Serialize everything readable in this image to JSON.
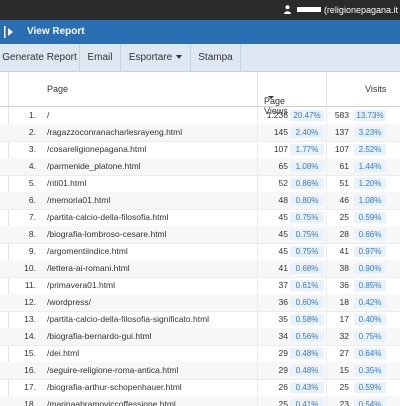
{
  "topbar": {
    "username": "(religionepagana.it"
  },
  "titlebar": {
    "title": "View Report"
  },
  "toolbar": {
    "generate": "Generate Report",
    "email": "Email",
    "export": "Esportare",
    "print": "Stampa"
  },
  "table": {
    "columns": {
      "page": "Page",
      "page_views": "Page Views",
      "visits": "Visits"
    },
    "rows": [
      {
        "num": "1.",
        "page": "/",
        "pv": "1.236",
        "pvp": "20.47%",
        "v": "583",
        "vp": "13.73%"
      },
      {
        "num": "2.",
        "page": "/ragazzoconranacharlesrayeng.html",
        "pv": "145",
        "pvp": "2.40%",
        "v": "137",
        "vp": "3.23%"
      },
      {
        "num": "3.",
        "page": "/cosareligionepagana.html",
        "pv": "107",
        "pvp": "1.77%",
        "v": "107",
        "vp": "2.52%"
      },
      {
        "num": "4.",
        "page": "/parmenide_platone.html",
        "pv": "65",
        "pvp": "1.08%",
        "v": "61",
        "vp": "1.44%"
      },
      {
        "num": "5.",
        "page": "/riti01.html",
        "pv": "52",
        "pvp": "0.86%",
        "v": "51",
        "vp": "1.20%"
      },
      {
        "num": "6.",
        "page": "/memoria01.html",
        "pv": "48",
        "pvp": "0.80%",
        "v": "46",
        "vp": "1.08%"
      },
      {
        "num": "7.",
        "page": "/partita-calcio-della-filosofia.html",
        "pv": "45",
        "pvp": "0.75%",
        "v": "25",
        "vp": "0.59%"
      },
      {
        "num": "8.",
        "page": "/biografia-lombroso-cesare.html",
        "pv": "45",
        "pvp": "0.75%",
        "v": "28",
        "vp": "0.66%"
      },
      {
        "num": "9.",
        "page": "/argomentiindice.html",
        "pv": "45",
        "pvp": "0.75%",
        "v": "41",
        "vp": "0.97%"
      },
      {
        "num": "10.",
        "page": "/lettera-ai-romani.html",
        "pv": "41",
        "pvp": "0.68%",
        "v": "38",
        "vp": "0.90%"
      },
      {
        "num": "11.",
        "page": "/primavera01.html",
        "pv": "37",
        "pvp": "0.61%",
        "v": "36",
        "vp": "0.85%"
      },
      {
        "num": "12.",
        "page": "/wordpress/",
        "pv": "36",
        "pvp": "0.60%",
        "v": "18",
        "vp": "0.42%"
      },
      {
        "num": "13.",
        "page": "/partita-calcio-della-filosofia-significato.html",
        "pv": "35",
        "pvp": "0.58%",
        "v": "17",
        "vp": "0.40%"
      },
      {
        "num": "14.",
        "page": "/biografia-bernardo-gui.html",
        "pv": "34",
        "pvp": "0.56%",
        "v": "32",
        "vp": "0.75%"
      },
      {
        "num": "15.",
        "page": "/dei.html",
        "pv": "29",
        "pvp": "0.48%",
        "v": "27",
        "vp": "0.64%"
      },
      {
        "num": "16.",
        "page": "/seguire-religione-roma-antica.html",
        "pv": "29",
        "pvp": "0.48%",
        "v": "15",
        "vp": "0.35%"
      },
      {
        "num": "17.",
        "page": "/biografia-arthur-schopenhauer.html",
        "pv": "26",
        "pvp": "0.43%",
        "v": "25",
        "vp": "0.59%"
      },
      {
        "num": "18.",
        "page": "/marinaabramoviccoffessione.html",
        "pv": "25",
        "pvp": "0.41%",
        "v": "23",
        "vp": "0.54%"
      }
    ]
  },
  "colors": {
    "topbar": "#2b2b2b",
    "titlebar": "#2a6fb4",
    "toolbar": "#dde8f3",
    "percent_badge_bg": "#e8f2fb",
    "percent_badge_text": "#3a7abd"
  }
}
